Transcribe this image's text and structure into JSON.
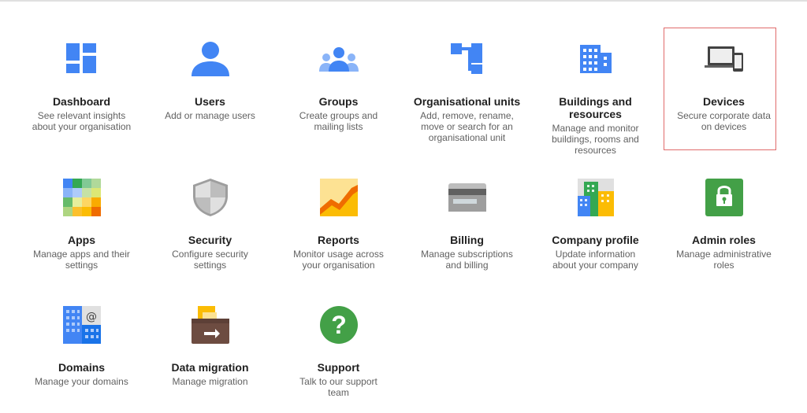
{
  "tiles": [
    {
      "title": "Dashboard",
      "desc": "See relevant insights about your organisation"
    },
    {
      "title": "Users",
      "desc": "Add or manage users"
    },
    {
      "title": "Groups",
      "desc": "Create groups and mailing lists"
    },
    {
      "title": "Organisational units",
      "desc": "Add, remove, rename, move or search for an organisational unit"
    },
    {
      "title": "Buildings and resources",
      "desc": "Manage and monitor buildings, rooms and resources"
    },
    {
      "title": "Devices",
      "desc": "Secure corporate data on devices"
    },
    {
      "title": "Apps",
      "desc": "Manage apps and their settings"
    },
    {
      "title": "Security",
      "desc": "Configure security settings"
    },
    {
      "title": "Reports",
      "desc": "Monitor usage across your organisation"
    },
    {
      "title": "Billing",
      "desc": "Manage subscriptions and billing"
    },
    {
      "title": "Company profile",
      "desc": "Update information about your company"
    },
    {
      "title": "Admin roles",
      "desc": "Manage administrative roles"
    },
    {
      "title": "Domains",
      "desc": "Manage your domains"
    },
    {
      "title": "Data migration",
      "desc": "Manage migration"
    },
    {
      "title": "Support",
      "desc": "Talk to our support team"
    }
  ],
  "icons": [
    "dashboard-icon",
    "users-icon",
    "groups-icon",
    "org-units-icon",
    "buildings-icon",
    "devices-icon",
    "apps-icon",
    "security-icon",
    "reports-icon",
    "billing-icon",
    "company-profile-icon",
    "admin-roles-icon",
    "domains-icon",
    "data-migration-icon",
    "support-icon"
  ],
  "highlighted_tile": "Devices",
  "colors": {
    "accent_blue": "#4285f4",
    "highlight_border": "#e06b6b",
    "green": "#4caf50"
  }
}
